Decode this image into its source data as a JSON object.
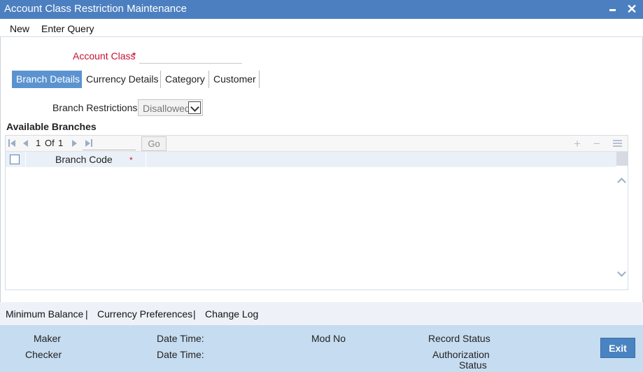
{
  "window": {
    "title": "Account Class Restriction Maintenance"
  },
  "menu": {
    "new": "New",
    "enter_query": "Enter Query"
  },
  "form": {
    "account_class_label": "Account Class",
    "required_marker": "*",
    "account_class_value": ""
  },
  "tabs": [
    {
      "label": "Branch Details",
      "active": true
    },
    {
      "label": "Currency Details",
      "active": false
    },
    {
      "label": "Category",
      "active": false
    },
    {
      "label": "Customer",
      "active": false
    }
  ],
  "branch": {
    "restrictions_label": "Branch Restrictions",
    "restrictions_value": "Disallowed",
    "available_label": "Available Branches"
  },
  "grid": {
    "page_current": "1",
    "page_of": "Of",
    "page_total": "1",
    "go_label": "Go",
    "column_branch_code": "Branch Code",
    "column_required": "*",
    "add_symbol": "+",
    "remove_symbol": "−"
  },
  "links": {
    "minimum_balance": "Minimum Balance",
    "currency_preferences": "Currency Preferences",
    "change_log": "Change Log",
    "separator": "|"
  },
  "footer": {
    "maker": "Maker",
    "checker": "Checker",
    "date_time_1": "Date Time:",
    "date_time_2": "Date Time:",
    "mod_no": "Mod No",
    "record_status": "Record Status",
    "authorization": "Authorization",
    "status": "Status",
    "exit": "Exit"
  },
  "colors": {
    "title_bar": "#4c7fc0",
    "active_tab": "#5b93d0",
    "footer_bg": "#c6dcf0",
    "required_red": "#c8102e"
  }
}
